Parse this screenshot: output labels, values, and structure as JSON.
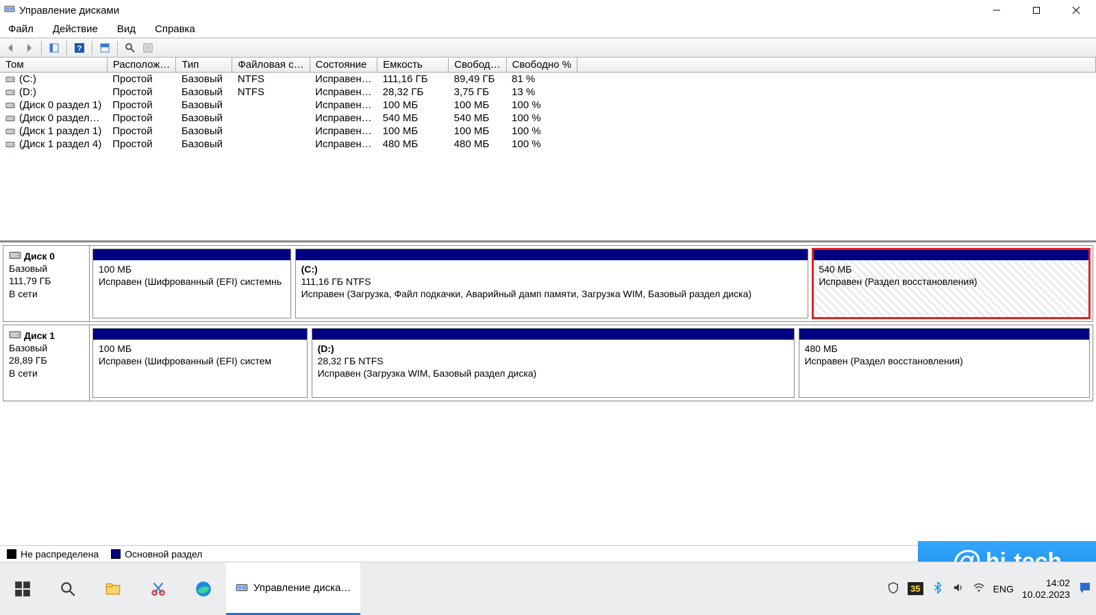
{
  "window": {
    "title": "Управление дисками"
  },
  "menu": {
    "file": "Файл",
    "action": "Действие",
    "view": "Вид",
    "help": "Справка"
  },
  "columns": {
    "volume": "Том",
    "layout": "Располож…",
    "type": "Тип",
    "fs": "Файловая с…",
    "status": "Состояние",
    "capacity": "Емкость",
    "free": "Свобод…",
    "freepct": "Свободно %"
  },
  "volumes": [
    {
      "name": "(C:)",
      "layout": "Простой",
      "type": "Базовый",
      "fs": "NTFS",
      "status": "Исправен…",
      "capacity": "111,16 ГБ",
      "free": "89,49 ГБ",
      "freepct": "81 %"
    },
    {
      "name": "(D:)",
      "layout": "Простой",
      "type": "Базовый",
      "fs": "NTFS",
      "status": "Исправен…",
      "capacity": "28,32 ГБ",
      "free": "3,75 ГБ",
      "freepct": "13 %"
    },
    {
      "name": "(Диск 0 раздел 1)",
      "layout": "Простой",
      "type": "Базовый",
      "fs": "",
      "status": "Исправен…",
      "capacity": "100 МБ",
      "free": "100 МБ",
      "freepct": "100 %"
    },
    {
      "name": "(Диск 0 раздел…",
      "layout": "Простой",
      "type": "Базовый",
      "fs": "",
      "status": "Исправен…",
      "capacity": "540 МБ",
      "free": "540 МБ",
      "freepct": "100 %"
    },
    {
      "name": "(Диск 1 раздел 1)",
      "layout": "Простой",
      "type": "Базовый",
      "fs": "",
      "status": "Исправен…",
      "capacity": "100 МБ",
      "free": "100 МБ",
      "freepct": "100 %"
    },
    {
      "name": "(Диск 1 раздел 4)",
      "layout": "Простой",
      "type": "Базовый",
      "fs": "",
      "status": "Исправен…",
      "capacity": "480 МБ",
      "free": "480 МБ",
      "freepct": "100 %"
    }
  ],
  "disks": [
    {
      "name": "Диск 0",
      "type": "Базовый",
      "size": "111,79 ГБ",
      "status": "В сети",
      "parts": [
        {
          "letter": "",
          "l2": "100 МБ",
          "l3": "Исправен (Шифрованный (EFI) системнь",
          "flex": 2.0
        },
        {
          "letter": "(C:)",
          "l2": "111,16 ГБ NTFS",
          "l3": "Исправен (Загрузка, Файл подкачки, Аварийный дамп памяти, Загрузка WIM, Базовый раздел диска)",
          "flex": 5.2
        },
        {
          "letter": "",
          "l2": "540 МБ",
          "l3": "Исправен (Раздел восстановления)",
          "flex": 2.8,
          "selected": true
        }
      ]
    },
    {
      "name": "Диск 1",
      "type": "Базовый",
      "size": "28,89 ГБ",
      "status": "В сети",
      "parts": [
        {
          "letter": "",
          "l2": "100 МБ",
          "l3": "Исправен (Шифрованный (EFI) систем",
          "flex": 1.95
        },
        {
          "letter": "(D:)",
          "l2": "28,32 ГБ NTFS",
          "l3": "Исправен (Загрузка WIM, Базовый раздел диска)",
          "flex": 4.4
        },
        {
          "letter": "",
          "l2": "480 МБ",
          "l3": "Исправен (Раздел восстановления)",
          "flex": 2.65
        }
      ]
    }
  ],
  "legend": {
    "unalloc": "Не распределена",
    "primary": "Основной раздел"
  },
  "taskbar": {
    "running_label": "Управление диска…",
    "lang": "ENG",
    "time": "14:02",
    "date": "10.02.2023",
    "badge": "35"
  },
  "watermark": "hi-tech"
}
